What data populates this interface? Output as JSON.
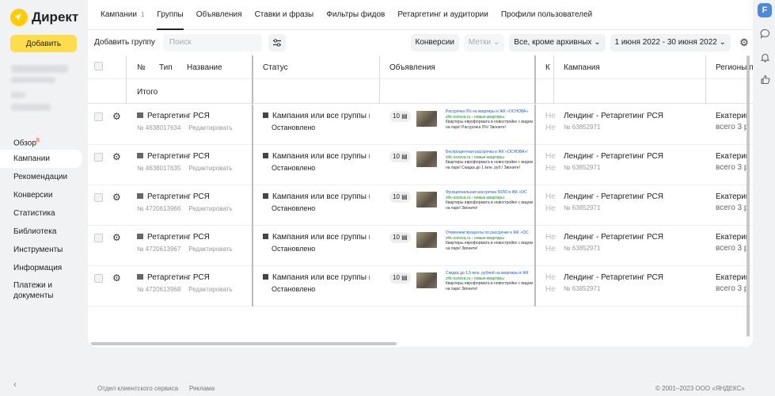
{
  "brand": {
    "name": "Директ"
  },
  "sidebar": {
    "add_label": "Добавить",
    "items": [
      {
        "label": "Обзор",
        "badge": "8"
      },
      {
        "label": "Кампании"
      },
      {
        "label": "Рекомендации"
      },
      {
        "label": "Конверсии"
      },
      {
        "label": "Статистика"
      },
      {
        "label": "Библиотека"
      },
      {
        "label": "Инструменты"
      },
      {
        "label": "Информация"
      },
      {
        "label": "Платежи и\nдокументы"
      }
    ],
    "collapse_glyph": "‹"
  },
  "tabs": [
    {
      "label": "Кампании",
      "count": "1"
    },
    {
      "label": "Группы"
    },
    {
      "label": "Объявления"
    },
    {
      "label": "Ставки и фразы"
    },
    {
      "label": "Фильтры фидов"
    },
    {
      "label": "Ретаргетинг и аудитории"
    },
    {
      "label": "Профили пользователей"
    }
  ],
  "toolbar": {
    "add_group": "Добавить группу",
    "search_placeholder": "Поиск",
    "conversions": "Конверсии",
    "tags": "Метки",
    "archive_filter": "Все, кроме архивных",
    "date_range": "1 июня 2022 - 30 июня 2022"
  },
  "table": {
    "headers": {
      "num": "№",
      "type": "Тип",
      "name": "Название",
      "status": "Статус",
      "ads": "Объявления",
      "k": "К",
      "campaign": "Кампания",
      "regions": "Регионы по"
    },
    "total_label": "Итого",
    "rows": [
      {
        "name": "Ретаргетинг РСЯ",
        "id": "№ 4638017634",
        "edit": "Редактировать",
        "status": "Кампания или все группы в...",
        "status_sub": "Остановлено",
        "ads_count": "10",
        "ad_title": "Рассрочка 0% на квартиры в ЖК «ОСНОВА»",
        "ad_url": "zhk-osnova.ru › новые-квартиры",
        "ad_desc": "Квартиры евроформата в новостройке с видом на парк! Рассрочка 0%! Звоните!",
        "k": "Не",
        "campaign": "Лендинг - Ретаргетинг РСЯ",
        "campaign_id": "№ 63852971",
        "region": "Екатерин",
        "region_sub": "всего 3 р"
      },
      {
        "name": "Ретаргетинг РСЯ",
        "id": "№ 4638017635",
        "edit": "Редактировать",
        "status": "Кампания или все группы в...",
        "status_sub": "Остановлено",
        "ads_count": "10",
        "ad_title": "Беспроцентная рассрочка в ЖК «ОСНОВА»!",
        "ad_url": "zhk-osnova.ru › новые-квартиры",
        "ad_desc": "Квартиры евроформата в новостройке с видом на парк! Скидка до 1 млн. руб.! Звоните!",
        "k": "Не",
        "campaign": "Лендинг - Ретаргетинг РСЯ",
        "campaign_id": "№ 63852971",
        "region": "Екатерин",
        "region_sub": "всего 3 р"
      },
      {
        "name": "Ретаргетинг РСЯ",
        "id": "№ 4720613966",
        "edit": "Редактировать",
        "status": "Кампания или все группы в...",
        "status_sub": "Остановлено",
        "ads_count": "10",
        "ad_title": "Функциональная рассрочка 50/50 в ЖК «ОС",
        "ad_url": "zhk-osnova.ru › новые-квартиры",
        "ad_desc": "Квартиры евроформата в новостройке с видом на парк! Звоните!",
        "k": "Не",
        "campaign": "Лендинг - Ретаргетинг РСЯ",
        "campaign_id": "№ 63852971",
        "region": "Екатерин",
        "region_sub": "всего 3 р"
      },
      {
        "name": "Ретаргетинг РСЯ",
        "id": "№ 4720613967",
        "edit": "Редактировать",
        "status": "Кампания или все группы в...",
        "status_sub": "Остановлено",
        "ads_count": "10",
        "ad_title": "Отменяем проценты по рассрочке в ЖК «ОС",
        "ad_url": "zhk-osnova.ru › новые-квартиры",
        "ad_desc": "Квартиры евроформата в новостройке с видом на парк! Звоните!",
        "k": "Не",
        "campaign": "Лендинг - Ретаргетинг РСЯ",
        "campaign_id": "№ 63852971",
        "region": "Екатерин",
        "region_sub": "всего 3 р"
      },
      {
        "name": "Ретаргетинг РСЯ",
        "id": "№ 4720613968",
        "edit": "Редактировать",
        "status": "Кампания или все группы в...",
        "status_sub": "Остановлено",
        "ads_count": "10",
        "ad_title": "Скидка до 1,5 млн. рублей на квартиры в ЖК",
        "ad_url": "zhk-osnova.ru › новые-квартиры",
        "ad_desc": "Квартиры евроформата в новостройке с видом на парк! Звоните!",
        "k": "Не",
        "campaign": "Лендинг - Ретаргетинг РСЯ",
        "campaign_id": "№ 63852971",
        "region": "Екатерин",
        "region_sub": "всего 3 р"
      }
    ]
  },
  "footer": {
    "support": "Отдел клиентского сервиса",
    "ads": "Реклама",
    "copyright": "© 2001–2023 ООО «ЯНДЕКС»"
  },
  "rail": {
    "avatar_letter": "F"
  },
  "colors": {
    "accent": "#fddc4d",
    "background": "#f1f2f4",
    "link_blue": "#1a5fd1",
    "url_green": "#1a8a2e"
  }
}
